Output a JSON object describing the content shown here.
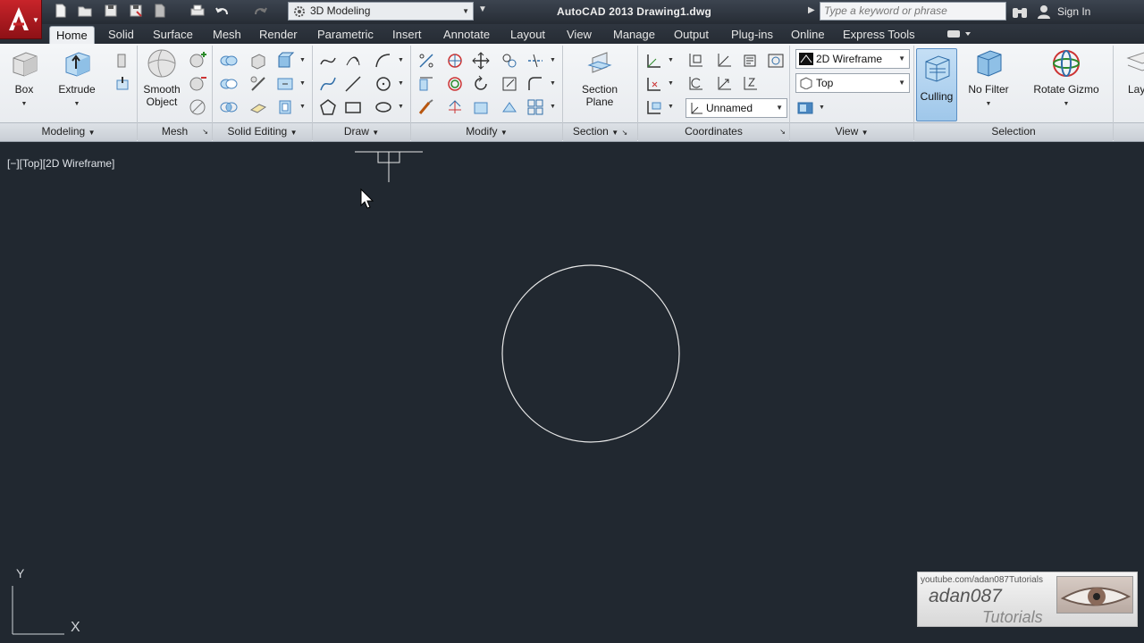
{
  "titlebar": {
    "workspace": "3D Modeling",
    "app_title": "AutoCAD 2013   Drawing1.dwg",
    "search_placeholder": "Type a keyword or phrase",
    "sign_in": "Sign In"
  },
  "tabs": [
    "Home",
    "Solid",
    "Surface",
    "Mesh",
    "Render",
    "Parametric",
    "Insert",
    "Annotate",
    "Layout",
    "View",
    "Manage",
    "Output",
    "Plug-ins",
    "Online",
    "Express Tools"
  ],
  "active_tab": "Home",
  "ribbon": {
    "box_label": "Box",
    "extrude_label": "Extrude",
    "smooth_label_1": "Smooth",
    "smooth_label_2": "Object",
    "section_plane_1": "Section",
    "section_plane_2": "Plane",
    "visual_style": "2D Wireframe",
    "view_name": "Top",
    "ucs_name": "Unnamed",
    "culling_label": "Culling",
    "no_filter_label": "No Filter",
    "rotate_gizmo_label": "Rotate Gizmo",
    "layers_label_fragment": "Lay",
    "panels": {
      "modeling": "Modeling",
      "mesh": "Mesh",
      "solid_editing": "Solid Editing",
      "draw": "Draw",
      "modify": "Modify",
      "section": "Section",
      "coordinates": "Coordinates",
      "view": "View",
      "selection": "Selection"
    }
  },
  "canvas": {
    "viewport_label": "[−][Top][2D Wireframe]",
    "ucs_y": "Y",
    "ucs_x": "X",
    "background": "#212830",
    "stroke": "#e8e8e8"
  },
  "watermark": {
    "url": "youtube.com/adan087Tutorials",
    "name": "adan087",
    "subtitle": "Tutorials"
  },
  "colors": {
    "accent_red": "#c8242a",
    "ribbon_bg": "#eceff2",
    "culling_active": "#aed1ef"
  }
}
